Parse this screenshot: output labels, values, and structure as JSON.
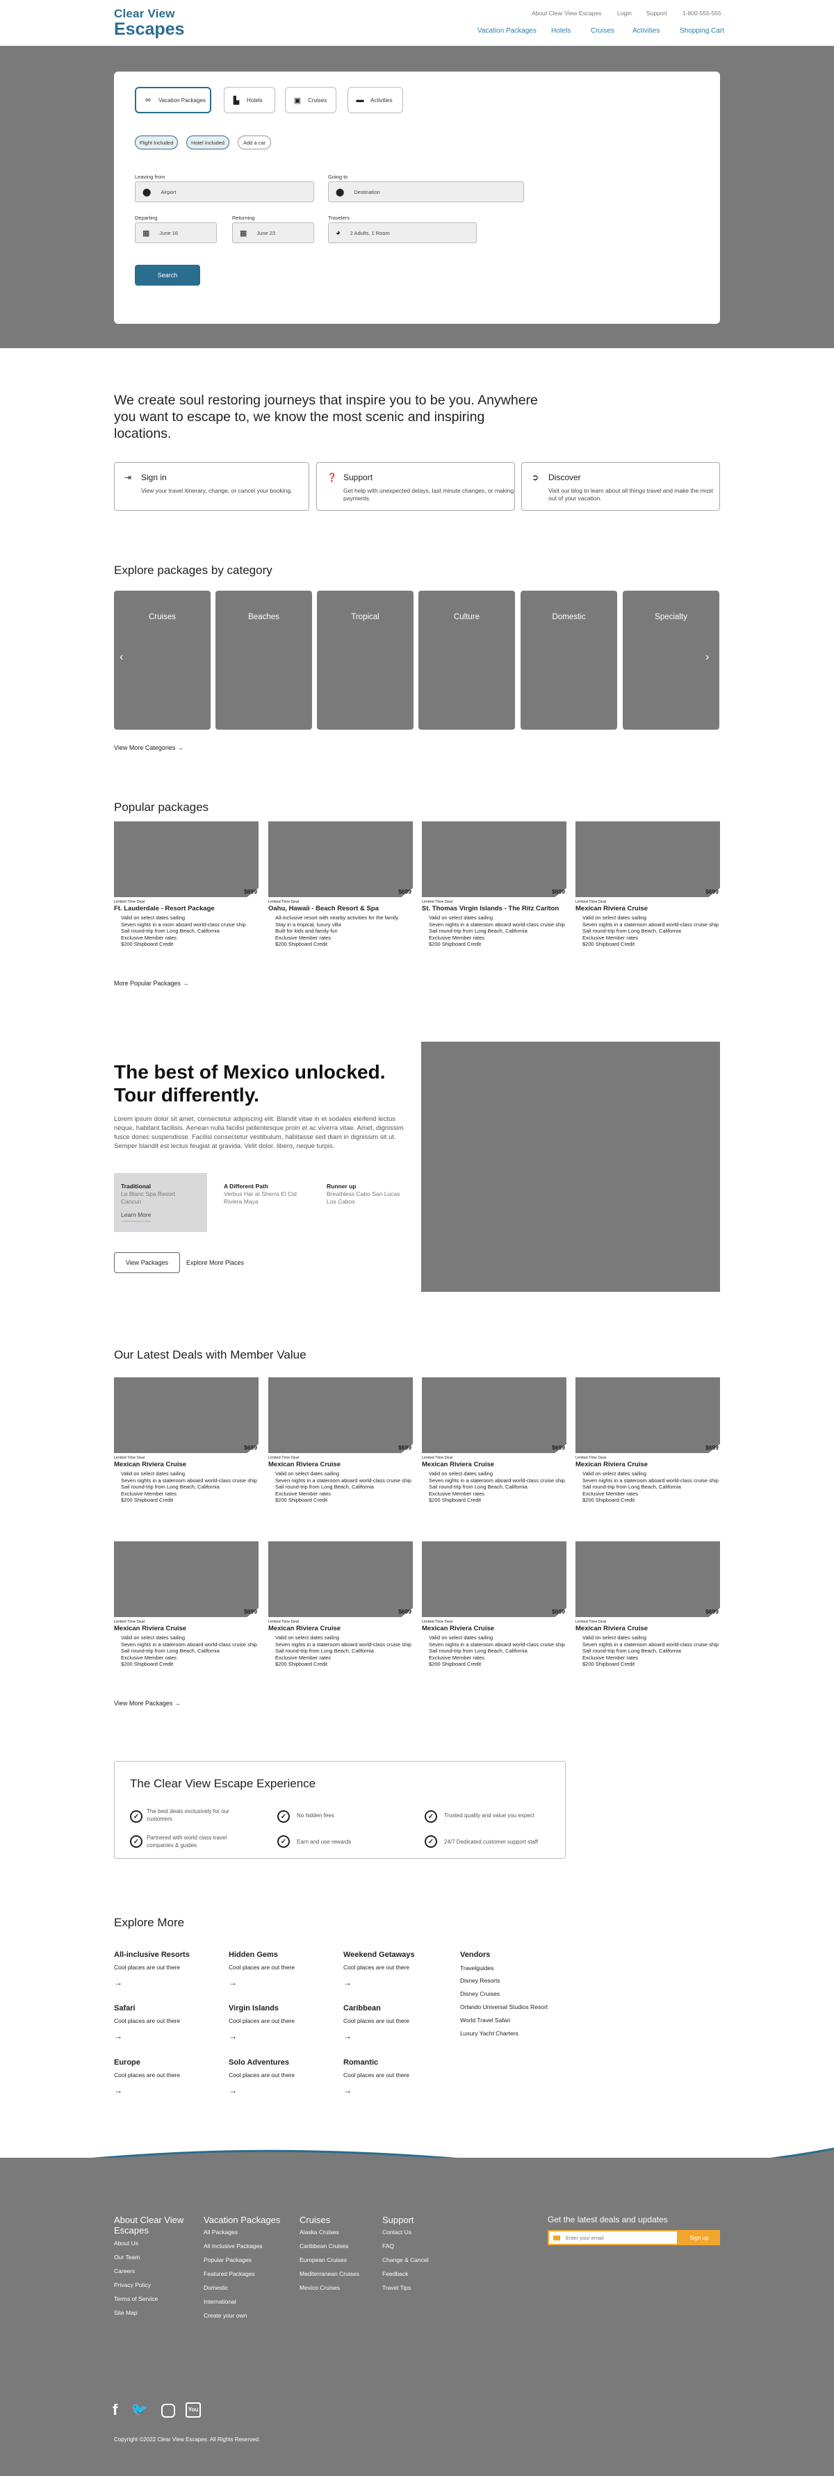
{
  "header": {
    "logo_line1": "Clear View",
    "logo_line2": "Escapes",
    "util_links": [
      "About Clear View Escapes",
      "Login",
      "Support",
      "1-800-555-555"
    ],
    "main_nav": [
      "Vacation Packages",
      "Hotels",
      "Cruises",
      "Activities",
      "Shopping Cart"
    ]
  },
  "search": {
    "tabs": [
      {
        "label": "Vacation Packages",
        "icon": "infinity-icon"
      },
      {
        "label": "Hotels",
        "icon": "building-icon"
      },
      {
        "label": "Cruises",
        "icon": "suitcase-icon"
      },
      {
        "label": "Activities",
        "icon": "ticket-icon"
      }
    ],
    "pills": [
      "Flight Included",
      "Hotel Included",
      "Add a car"
    ],
    "leaving_label": "Leaving from",
    "leaving_value": "Airport",
    "going_label": "Going to",
    "going_value": "Destination",
    "departing_label": "Departing",
    "departing_value": "June 16",
    "returning_label": "Returning",
    "returning_value": "June 23",
    "travelers_label": "Travelers",
    "travelers_value": "2 Adults, 1 Room",
    "search_label": "Search"
  },
  "intro": {
    "text": "We create soul restoring journeys that inspire you to be you. Anywhere you want to escape to, we know the most scenic and inspiring locations."
  },
  "cards": [
    {
      "title": "Sign in",
      "desc": "View your travel itinerary, change, or cancel your booking.",
      "icon": "sign-in-icon"
    },
    {
      "title": "Support",
      "desc": "Get help with unexpected delays, last minute changes, or making payments.",
      "icon": "help-icon"
    },
    {
      "title": "Discover",
      "desc": "Visit our blog to learn about all things travel and make the most out of your vacation.",
      "icon": "compass-icon"
    }
  ],
  "categories": {
    "title": "Explore packages by category",
    "items": [
      "Cruises",
      "Beaches",
      "Tropical",
      "Culture",
      "Domestic",
      "Specialty"
    ],
    "more": "View More Categories"
  },
  "popular": {
    "title": "Popular packages",
    "items": [
      {
        "tag": "Limited Time Deal",
        "price": "$699",
        "name": "Ft. Lauderdale - Resort Package",
        "bullets": [
          "Valid on select dates sailing",
          "Seven nights in a room aboard world-class cruise ship",
          "Sail round-trip from Long Beach, California",
          "Exclusive Member rates",
          "$200 Shipboard Credit"
        ]
      },
      {
        "tag": "Limited Time Deal",
        "price": "$699",
        "name": "Oahu, Hawaii - Beach Resort & Spa",
        "bullets": [
          "All-inclusive resort with nearby activities for the family",
          "Stay in a tropical, luxury villa",
          "Built for kids and family fun",
          "Exclusive Member rates",
          "$200 Shipboard Credit"
        ]
      },
      {
        "tag": "Limited Time Deal",
        "price": "$699",
        "name": "St. Thomas Virgin Islands - The Ritz Carlton",
        "bullets": [
          "Valid on select dates sailing",
          "Seven nights in a stateroom aboard world-class cruise ship",
          "Sail round-trip from Long Beach, California",
          "Exclusive Member rates",
          "$200 Shipboard Credit"
        ]
      },
      {
        "tag": "Limited Time Deal",
        "price": "$699",
        "name": "Mexican Riviera Cruise",
        "bullets": [
          "Valid on select dates sailing",
          "Seven nights in a stateroom aboard world-class cruise ship",
          "Sail round-trip from Long Beach, California",
          "Exclusive Member rates",
          "$200 Shipboard Credit"
        ]
      }
    ],
    "more": "More Popular Packages"
  },
  "mexico": {
    "heading_line1": "The best of Mexico unlocked.",
    "heading_line2": "Tour differently.",
    "para": "Lorem ipsum dolor sit amet, consectetur adipiscing elit. Blandit vitae in et sodales eleifend lectus neque, habitant facilisis. Aenean nulla facilisi pellentesque proin et ac viverra vitae. Amet, dignissim fusce donec suspendisse. Facilisi consectetur vestibulum, habitasse sed diam in dignissim sit ut. Semper blandit est lectus feugiat at gravida. Velit dolor, libero, neque turpis.",
    "cols": [
      {
        "title": "Traditional",
        "lines": [
          "Le Blanc Spa Resort",
          "Cancun"
        ],
        "link": "Learn More"
      },
      {
        "title": "A Different Path",
        "lines": [
          "Verbus Har at Sherra El Cid",
          "Riviera Maya"
        ]
      },
      {
        "title": "Runner up",
        "lines": [
          "Breathless Cabo San Lucas",
          "Los Cabos"
        ]
      }
    ],
    "view_btn": "View Packages",
    "explore_btn": "Explore More Places"
  },
  "deals": {
    "title": "Our Latest Deals with Member Value",
    "item": {
      "tag": "Limited Time Deal",
      "price": "$699",
      "name": "Mexican Riviera Cruise",
      "bullets": [
        "Valid on select dates sailing",
        "Seven nights in a stateroom aboard world-class cruise ship",
        "Sail round-trip from Long Beach, California",
        "Exclusive Member rates",
        "$200 Shipboard Credit"
      ]
    },
    "more": "View More Packages"
  },
  "experience": {
    "title": "The Clear View Escape Experience",
    "items": [
      "The best deals exclusively for our customers",
      "No hidden fees",
      "Trusted quality and value you expect",
      "Partnered with world class travel companies & guides",
      "Earn and use rewards",
      "24/7 Dedicated customer support staff"
    ]
  },
  "explore_more": {
    "title": "Explore More",
    "columns": [
      [
        {
          "h": "All-inclusive Resorts",
          "s": "Cool places are out there"
        },
        {
          "h": "Safari",
          "s": "Cool places are out there"
        },
        {
          "h": "Europe",
          "s": "Cool places are out there"
        }
      ],
      [
        {
          "h": "Hidden Gems",
          "s": "Cool places are out there"
        },
        {
          "h": "Virgin Islands",
          "s": "Cool places are out there"
        },
        {
          "h": "Solo Adventures",
          "s": "Cool places are out there"
        }
      ],
      [
        {
          "h": "Weekend Getaways",
          "s": "Cool places are out there"
        },
        {
          "h": "Caribbean",
          "s": "Cool places are out there"
        },
        {
          "h": "Romantic",
          "s": "Cool places are out there"
        }
      ]
    ],
    "vendors_title": "Vendors",
    "vendors": [
      "Travelguides",
      "Disney Resorts",
      "Disney Cruises",
      "Orlando Universal Studios Resort",
      "World Travel Safari",
      "Luxury Yacht Charters"
    ]
  },
  "footer": {
    "col1_title": "About Clear View Escapes",
    "col1_links": [
      "About Us",
      "Our Team",
      "Careers",
      "Privacy Policy",
      "Terms of Service",
      "Site Map"
    ],
    "col2_title": "Vacation Packages",
    "col2_links": [
      "All Packages",
      "All Inclusive Packages",
      "Popular Packages",
      "Featured Packages",
      "Domestic",
      "International",
      "Create your own"
    ],
    "col3_title": "Cruises",
    "col3_links": [
      "Alaska Cruises",
      "Caribbean Cruises",
      "European Cruises",
      "Mediterranean Cruises",
      "Mexico Cruises"
    ],
    "col4_title": "Support",
    "col4_links": [
      "Contact Us",
      "FAQ",
      "Change & Cancel",
      "Feedback",
      "Travel Tips"
    ],
    "newsletter_title": "Get the latest deals and updates",
    "email_placeholder": "Enter your email",
    "signup": "Sign up",
    "copyright": "Copyright ©2022 Clear View Escapes. All Rights Reserved."
  }
}
